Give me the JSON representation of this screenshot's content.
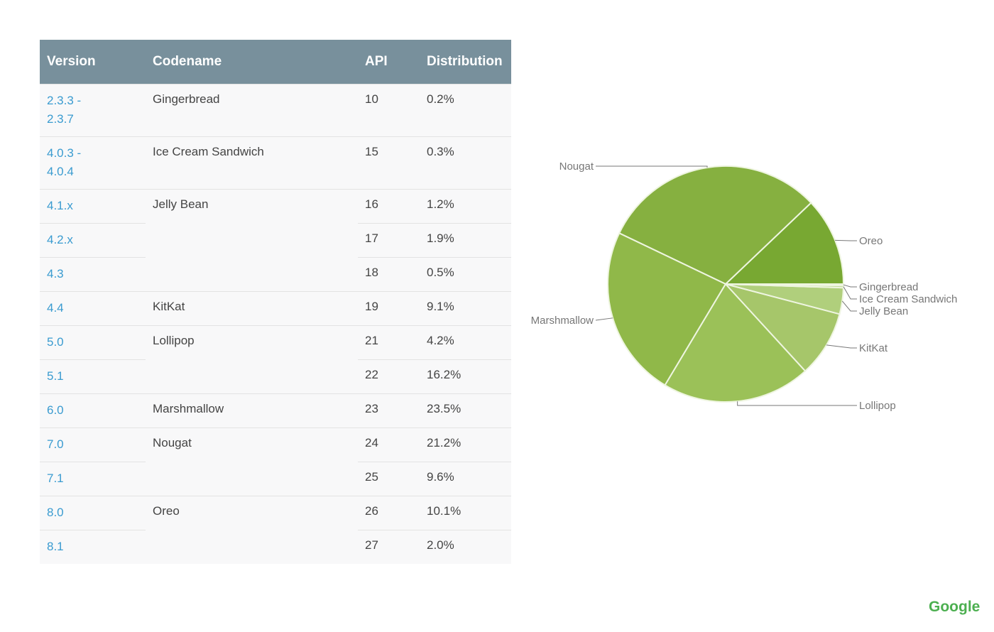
{
  "table": {
    "headers": [
      "Version",
      "Codename",
      "API",
      "Distribution"
    ],
    "rows": [
      {
        "version": "2.3.3 -\n2.3.7",
        "codename": "Gingerbread",
        "api": "10",
        "dist": "0.2%"
      },
      {
        "version": "4.0.3 -\n4.0.4",
        "codename": "Ice Cream Sandwich",
        "api": "15",
        "dist": "0.3%"
      },
      {
        "version": "4.1.x",
        "codename": "Jelly Bean",
        "api": "16",
        "dist": "1.2%"
      },
      {
        "version": "4.2.x",
        "codename": "",
        "api": "17",
        "dist": "1.9%"
      },
      {
        "version": "4.3",
        "codename": "",
        "api": "18",
        "dist": "0.5%"
      },
      {
        "version": "4.4",
        "codename": "KitKat",
        "api": "19",
        "dist": "9.1%"
      },
      {
        "version": "5.0",
        "codename": "Lollipop",
        "api": "21",
        "dist": "4.2%"
      },
      {
        "version": "5.1",
        "codename": "",
        "api": "22",
        "dist": "16.2%"
      },
      {
        "version": "6.0",
        "codename": "Marshmallow",
        "api": "23",
        "dist": "23.5%"
      },
      {
        "version": "7.0",
        "codename": "Nougat",
        "api": "24",
        "dist": "21.2%"
      },
      {
        "version": "7.1",
        "codename": "",
        "api": "25",
        "dist": "9.6%"
      },
      {
        "version": "8.0",
        "codename": "Oreo",
        "api": "26",
        "dist": "10.1%"
      },
      {
        "version": "8.1",
        "codename": "",
        "api": "27",
        "dist": "2.0%"
      }
    ]
  },
  "chart_data": {
    "type": "pie",
    "title": "",
    "start": "3 o'clock, counterclockwise",
    "slices": [
      {
        "label": "Oreo",
        "value": 12.1,
        "color": "#78a832"
      },
      {
        "label": "Nougat",
        "value": 30.8,
        "color": "#86b040"
      },
      {
        "label": "Marshmallow",
        "value": 23.5,
        "color": "#90b849"
      },
      {
        "label": "Lollipop",
        "value": 20.4,
        "color": "#9bc158"
      },
      {
        "label": "KitKat",
        "value": 9.1,
        "color": "#a6c66a"
      },
      {
        "label": "Jelly Bean",
        "value": 3.6,
        "color": "#b0cf7c"
      },
      {
        "label": "Ice Cream Sandwich",
        "value": 0.3,
        "color": "#c0d99a"
      },
      {
        "label": "Gingerbread",
        "value": 0.2,
        "color": "#d0e4b4"
      }
    ]
  },
  "brand": {
    "logo_text": "Google",
    "color": "#4caf50"
  }
}
